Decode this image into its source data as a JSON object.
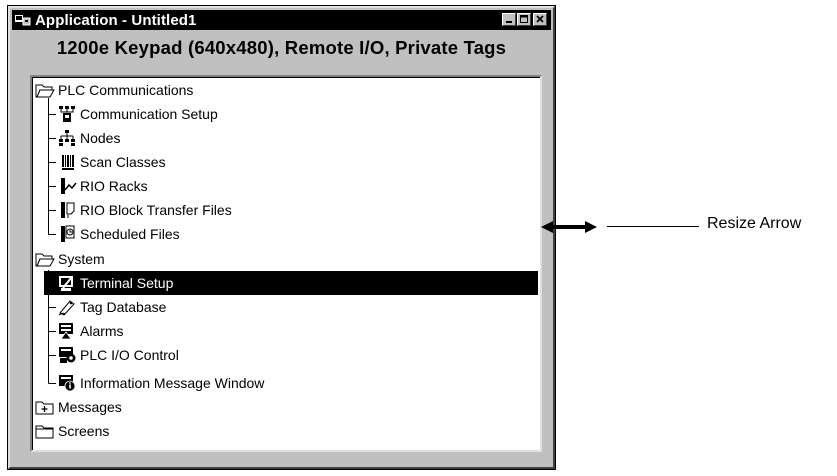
{
  "window": {
    "title": "Application - Untitled1",
    "subtitle": "1200e Keypad (640x480), Remote I/O, Private Tags"
  },
  "tree": {
    "plc_communications": {
      "label": "PLC Communications",
      "children": [
        {
          "label": "Communication Setup",
          "icon": "communication-setup-icon"
        },
        {
          "label": "Nodes",
          "icon": "nodes-icon"
        },
        {
          "label": "Scan Classes",
          "icon": "scan-classes-icon"
        },
        {
          "label": "RIO Racks",
          "icon": "rio-racks-icon"
        },
        {
          "label": "RIO Block Transfer Files",
          "icon": "rio-block-transfer-icon"
        },
        {
          "label": "Scheduled Files",
          "icon": "scheduled-files-icon"
        }
      ]
    },
    "system": {
      "label": "System",
      "children": [
        {
          "label": "Terminal Setup",
          "icon": "terminal-setup-icon",
          "selected": true
        },
        {
          "label": "Tag Database",
          "icon": "tag-database-icon"
        },
        {
          "label": "Alarms",
          "icon": "alarms-icon"
        },
        {
          "label": "PLC I/O Control",
          "icon": "plc-io-control-icon"
        },
        {
          "label": "Information Message Window",
          "icon": "information-message-icon"
        }
      ]
    },
    "messages": {
      "label": "Messages",
      "expander": "+"
    },
    "screens": {
      "label": "Screens"
    }
  },
  "callout": {
    "label": "Resize Arrow",
    "icon": "resize-arrow-icon"
  },
  "colors": {
    "window_face": "#c0c0c0",
    "titlebar": "#000000",
    "selection": "#000000",
    "panel": "#ffffff"
  }
}
